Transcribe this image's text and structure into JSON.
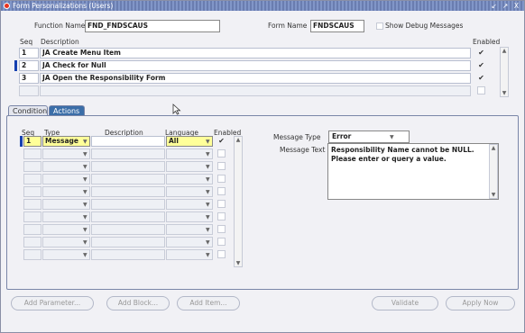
{
  "window": {
    "title": "Form Personalizations (Users)",
    "controls": "↙ ↗ X"
  },
  "header": {
    "function_name_label": "Function Name",
    "function_name_value": "FND_FNDSCAUS",
    "form_name_label": "Form Name",
    "form_name_value": "FNDSCAUS",
    "debug_label": "Show Debug Messages"
  },
  "rules": {
    "seq_header": "Seq",
    "description_header": "Description",
    "enabled_header": "Enabled",
    "rows": [
      {
        "seq": "1",
        "description": "JA Create Menu Item",
        "enabled": true
      },
      {
        "seq": "2",
        "description": "JA Check for Null",
        "enabled": true
      },
      {
        "seq": "3",
        "description": "JA Open the Responsibility Form",
        "enabled": true
      },
      {
        "seq": "",
        "description": "",
        "enabled": false
      }
    ]
  },
  "tabs": [
    {
      "label": "Condition",
      "active": false
    },
    {
      "label": "Actions",
      "active": true
    }
  ],
  "actions": {
    "seq_header": "Seq",
    "type_header": "Type",
    "description_header": "Description",
    "language_header": "Language",
    "enabled_header": "Enabled",
    "first_row": {
      "seq": "1",
      "type": "Message",
      "description": "",
      "language": "All",
      "enabled": true
    },
    "empty_rows": 9
  },
  "message": {
    "type_label": "Message Type",
    "type_value": "Error",
    "text_label": "Message Text",
    "text_value": "Responsibility Name cannot be NULL.\nPlease enter or query a value."
  },
  "buttons": {
    "add_parameter": "Add Parameter...",
    "add_block": "Add Block...",
    "add_item": "Add Item...",
    "validate": "Validate",
    "apply_now": "Apply Now"
  }
}
